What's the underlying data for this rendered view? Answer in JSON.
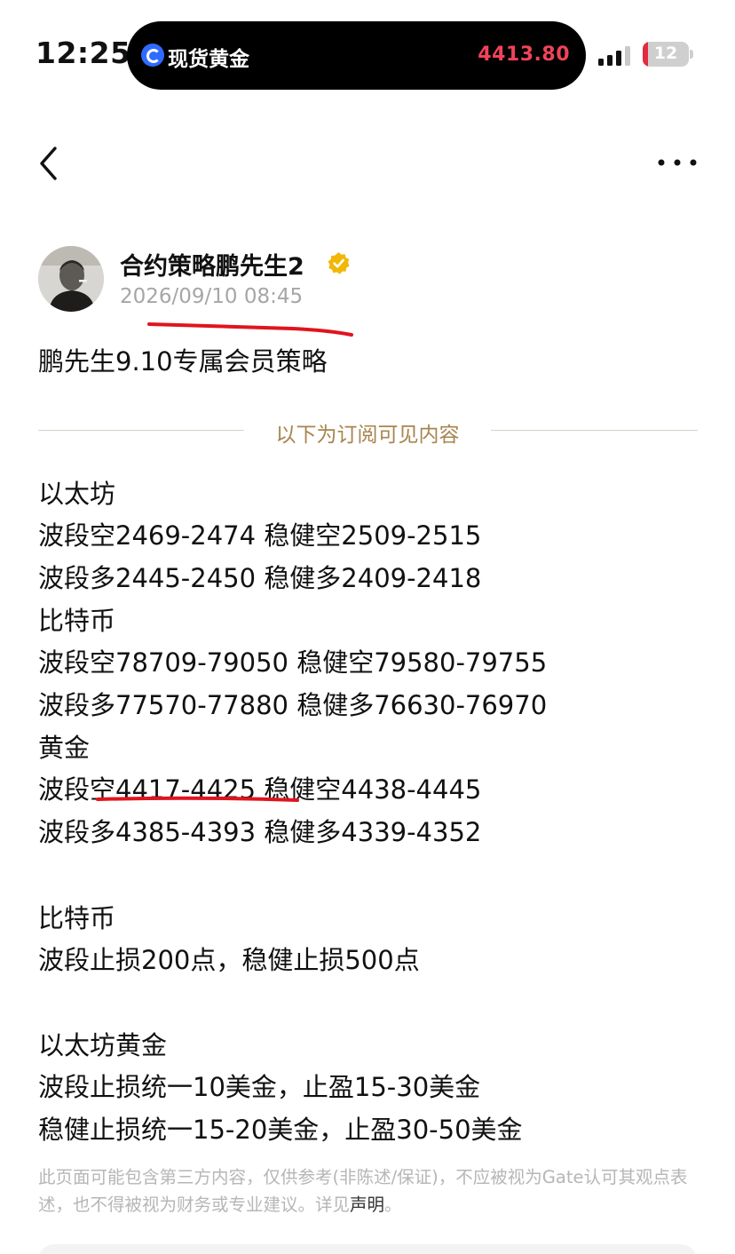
{
  "status_bar": {
    "time": "12:25",
    "island_title": "现货黄金",
    "island_price": "4413.80",
    "battery_level": "12",
    "battery_fraction": 0.12
  },
  "nav": {
    "back_icon": "chevron-left-icon",
    "more_icon": "more-dots-icon"
  },
  "author": {
    "name": "合约策略鹏先生2",
    "verified_icon": "verified-badge-icon",
    "verified_color": "#f2b705",
    "timestamp": "2026/09/10 08:45"
  },
  "post": {
    "title": "鹏先生9.10专属会员策略",
    "divider_text": "以下为订阅可见内容",
    "lines": [
      "以太坊",
      "波段空2469-2474 稳健空2509-2515",
      "波段多2445-2450 稳健多2409-2418",
      "比特币",
      "波段空78709-79050 稳健空79580-79755",
      "波段多77570-77880 稳健多76630-76970",
      "黄金",
      "波段空4417-4425 稳健空4438-4445",
      "波段多4385-4393 稳健多4339-4352",
      "",
      "比特币",
      "波段止损200点，稳健止损500点",
      "",
      "以太坊黄金",
      "波段止损统一10美金，止盈15-30美金",
      "稳健止损统一15-20美金，止盈30-50美金"
    ]
  },
  "disclaimer": {
    "text": "此页面可能包含第三方内容，仅供参考(非陈述/保证)，不应被视为Gate认可其观点表述，也不得被视为财务或专业建议。详见",
    "link": "声明",
    "suffix": "。"
  },
  "colors": {
    "price_red": "#f0435a",
    "divider_gold": "#a8844f",
    "annotation_red": "#e0141e"
  }
}
